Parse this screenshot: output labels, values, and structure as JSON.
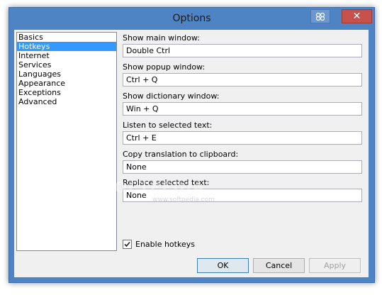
{
  "window": {
    "title": "Options",
    "close_glyph": "✕"
  },
  "categories": [
    {
      "label": "Basics",
      "selected": false
    },
    {
      "label": "Hotkeys",
      "selected": true
    },
    {
      "label": "Internet",
      "selected": false
    },
    {
      "label": "Services",
      "selected": false
    },
    {
      "label": "Languages",
      "selected": false
    },
    {
      "label": "Appearance",
      "selected": false
    },
    {
      "label": "Exceptions",
      "selected": false
    },
    {
      "label": "Advanced",
      "selected": false
    }
  ],
  "fields": {
    "main_window": {
      "label": "Show main window:",
      "value": "Double Ctrl"
    },
    "popup_window": {
      "label": "Show popup window:",
      "value": "Ctrl + Q"
    },
    "dictionary_window": {
      "label": "Show dictionary window:",
      "value": "Win + Q"
    },
    "listen_selected": {
      "label": "Listen to selected text:",
      "value": "Ctrl + E"
    },
    "copy_translation": {
      "label": "Copy translation to clipboard:",
      "value": "None"
    },
    "replace_selected": {
      "label": "Replace selected text:",
      "value": "None"
    }
  },
  "enable_hotkeys": {
    "label": "Enable hotkeys",
    "checked": true
  },
  "buttons": {
    "ok": "OK",
    "cancel": "Cancel",
    "apply": "Apply"
  },
  "watermark": {
    "main": "SOFTPEDIA",
    "sub": "www.softpedia.com"
  },
  "colors": {
    "titlebar": "#4f84c4",
    "selection": "#3399ff",
    "close_button": "#c7514b"
  }
}
